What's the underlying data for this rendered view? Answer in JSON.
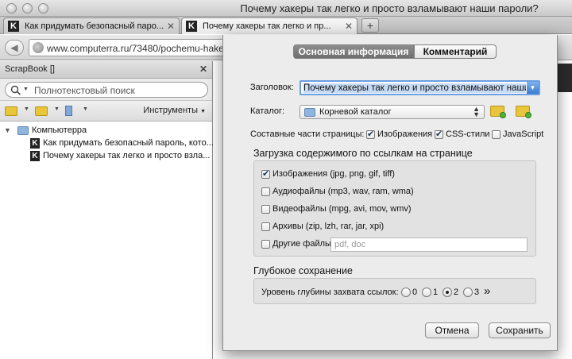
{
  "window": {
    "title": "Почему хакеры так легко и просто взламывают наши пароли?"
  },
  "tabs": [
    {
      "label": "Как придумать безопасный паро...",
      "favicon": "K",
      "close": "✕"
    },
    {
      "label": "Почему хакеры так легко и пр...",
      "favicon": "K",
      "close": "✕"
    }
  ],
  "new_tab": "+",
  "nav": {
    "back": "◀",
    "url": "www.computerra.ru/73480/pochemu-hake"
  },
  "sidebar": {
    "title": "ScrapBook []",
    "close": "✕",
    "search_placeholder": "Полнотекстовый поиск",
    "tools_label": "Инструменты",
    "tree": {
      "folder": "Компьютерра",
      "items": [
        "Как придумать безопасный пароль, кото...",
        "Почему хакеры так легко и просто взла..."
      ]
    }
  },
  "dialog": {
    "tabs": {
      "main": "Основная информация",
      "comment": "Комментарий"
    },
    "title_label": "Заголовок:",
    "title_value": "Почему хакеры так легко и просто взламывают наши пароли?",
    "catalog_label": "Каталог:",
    "catalog_value": "Корневой каталог",
    "parts_label": "Составные части страницы:",
    "parts": [
      {
        "label": "Изображения",
        "checked": true
      },
      {
        "label": "CSS-стили",
        "checked": true
      },
      {
        "label": "JavaScript",
        "checked": false
      }
    ],
    "links_section": "Загрузка содержимого по ссылкам на странице",
    "link_options": [
      {
        "label": "Изображения (jpg, png, gif, tiff)",
        "checked": true
      },
      {
        "label": "Аудиофайлы (mp3, wav, ram, wma)",
        "checked": false
      },
      {
        "label": "Видеофайлы (mpg, avi, mov, wmv)",
        "checked": false
      },
      {
        "label": "Архивы (zip, lzh, rar, jar, xpi)",
        "checked": false
      },
      {
        "label": "Другие файлы",
        "checked": false
      }
    ],
    "other_placeholder": "pdf, doc",
    "deep_section": "Глубокое сохранение",
    "depth_label": "Уровень глубины захвата ссылок:",
    "depth_options": [
      "0",
      "1",
      "2",
      "3"
    ],
    "depth_selected": "2",
    "more": "»",
    "cancel": "Отмена",
    "save": "Сохранить"
  },
  "colors": {
    "focus_ring": "#6a9fe0",
    "segment_active": "#7a7a7a",
    "folder_yellow": "#e8c53a"
  }
}
